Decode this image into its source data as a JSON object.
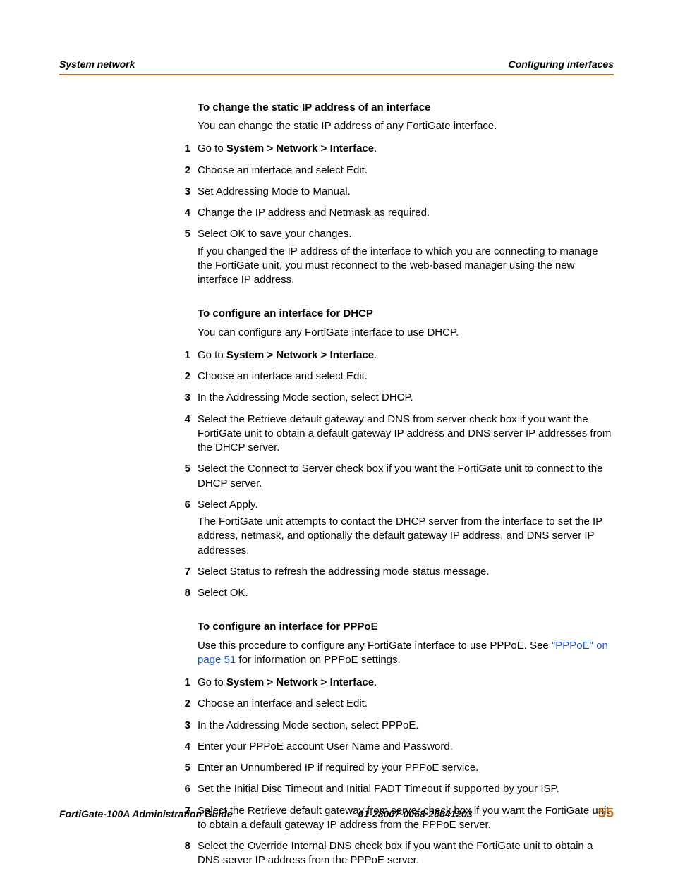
{
  "header": {
    "left": "System network",
    "right": "Configuring interfaces"
  },
  "sec1": {
    "title": "To change the static IP address of an interface",
    "intro": "You can change the static IP address of any FortiGate interface.",
    "steps": [
      {
        "n": "1",
        "pre": "Go to ",
        "bold": "System > Network > Interface",
        "post": "."
      },
      {
        "n": "2",
        "pre": "Choose an interface and select Edit."
      },
      {
        "n": "3",
        "pre": "Set Addressing Mode to Manual."
      },
      {
        "n": "4",
        "pre": "Change the IP address and Netmask as required."
      },
      {
        "n": "5",
        "pre": "Select OK to save your changes.",
        "extra": "If you changed the IP address of the interface to which you are connecting to manage the FortiGate unit, you must reconnect to the web-based manager using the new interface IP address."
      }
    ]
  },
  "sec2": {
    "title": "To configure an interface for DHCP",
    "intro": "You can configure any FortiGate interface to use DHCP.",
    "steps": [
      {
        "n": "1",
        "pre": "Go to ",
        "bold": "System > Network > Interface",
        "post": "."
      },
      {
        "n": "2",
        "pre": "Choose an interface and select Edit."
      },
      {
        "n": "3",
        "pre": "In the Addressing Mode section, select DHCP."
      },
      {
        "n": "4",
        "pre": "Select the Retrieve default gateway and DNS from server check box if you want the FortiGate unit to obtain a default gateway IP address and DNS server IP addresses from the DHCP server."
      },
      {
        "n": "5",
        "pre": "Select the Connect to Server check box if you want the FortiGate unit to connect to the DHCP server."
      },
      {
        "n": "6",
        "pre": "Select Apply.",
        "extra": "The FortiGate unit attempts to contact the DHCP server from the interface to set the IP address, netmask, and optionally the default gateway IP address, and DNS server IP addresses."
      },
      {
        "n": "7",
        "pre": "Select Status to refresh the addressing mode status message."
      },
      {
        "n": "8",
        "pre": "Select OK."
      }
    ]
  },
  "sec3": {
    "title": "To configure an interface for PPPoE",
    "intro_pre": "Use this procedure to configure any FortiGate interface to use PPPoE. See ",
    "intro_link": "\"PPPoE\" on page 51",
    "intro_post": " for information on PPPoE settings.",
    "steps": [
      {
        "n": "1",
        "pre": "Go to ",
        "bold": "System > Network > Interface",
        "post": "."
      },
      {
        "n": "2",
        "pre": "Choose an interface and select Edit."
      },
      {
        "n": "3",
        "pre": "In the Addressing Mode section, select PPPoE."
      },
      {
        "n": "4",
        "pre": "Enter your PPPoE account User Name and Password."
      },
      {
        "n": "5",
        "pre": "Enter an Unnumbered IP if required by your PPPoE service."
      },
      {
        "n": "6",
        "pre": "Set the Initial Disc Timeout and Initial PADT Timeout if supported by your ISP."
      },
      {
        "n": "7",
        "pre": "Select the Retrieve default gateway from server check box if you want the FortiGate unit to obtain a default gateway IP address from the PPPoE server."
      },
      {
        "n": "8",
        "pre": "Select the Override Internal DNS check box if you want the FortiGate unit to obtain a DNS server IP address from the PPPoE server."
      }
    ]
  },
  "footer": {
    "guide": "FortiGate-100A Administration Guide",
    "docnum": "01-28007-0068-20041203",
    "page": "55"
  }
}
